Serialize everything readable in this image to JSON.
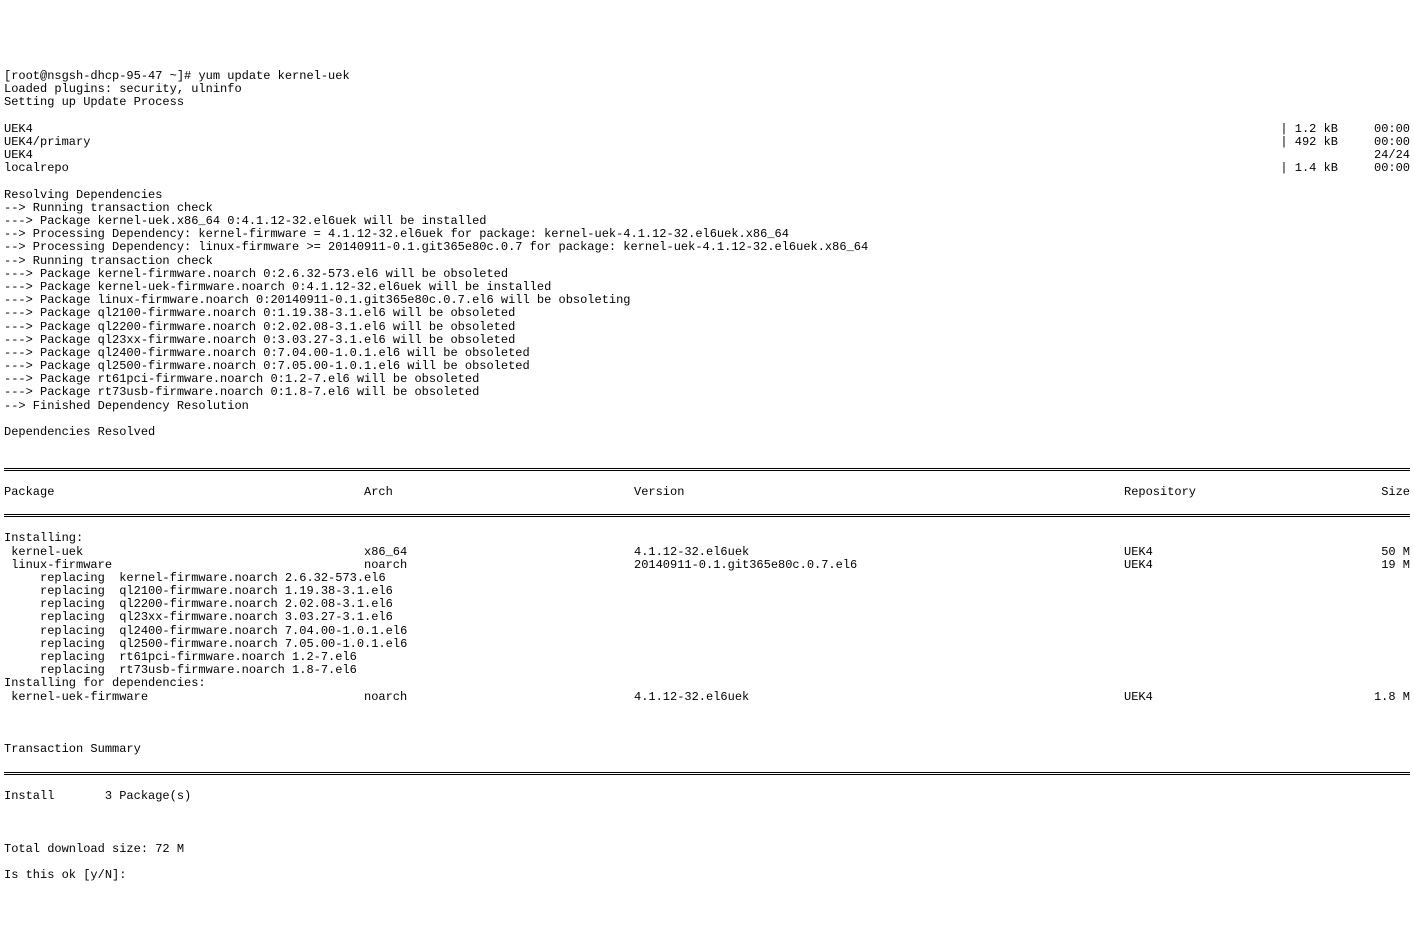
{
  "prompt": "[root@nsgsh-dhcp-95-47 ~]# ",
  "command": "yum update kernel-uek",
  "preamble": [
    "Loaded plugins: security, ulninfo",
    "Setting up Update Process"
  ],
  "repos": [
    {
      "name": "UEK4",
      "right": "| 1.2 kB     00:00"
    },
    {
      "name": "UEK4/primary",
      "right": "| 492 kB     00:00"
    },
    {
      "name": "UEK4",
      "right": "24/24"
    },
    {
      "name": "localrepo",
      "right": "| 1.4 kB     00:00"
    }
  ],
  "deps": [
    "Resolving Dependencies",
    "--> Running transaction check",
    "---> Package kernel-uek.x86_64 0:4.1.12-32.el6uek will be installed",
    "--> Processing Dependency: kernel-firmware = 4.1.12-32.el6uek for package: kernel-uek-4.1.12-32.el6uek.x86_64",
    "--> Processing Dependency: linux-firmware >= 20140911-0.1.git365e80c.0.7 for package: kernel-uek-4.1.12-32.el6uek.x86_64",
    "--> Running transaction check",
    "---> Package kernel-firmware.noarch 0:2.6.32-573.el6 will be obsoleted",
    "---> Package kernel-uek-firmware.noarch 0:4.1.12-32.el6uek will be installed",
    "---> Package linux-firmware.noarch 0:20140911-0.1.git365e80c.0.7.el6 will be obsoleting",
    "---> Package ql2100-firmware.noarch 0:1.19.38-3.1.el6 will be obsoleted",
    "---> Package ql2200-firmware.noarch 0:2.02.08-3.1.el6 will be obsoleted",
    "---> Package ql23xx-firmware.noarch 0:3.03.27-3.1.el6 will be obsoleted",
    "---> Package ql2400-firmware.noarch 0:7.04.00-1.0.1.el6 will be obsoleted",
    "---> Package ql2500-firmware.noarch 0:7.05.00-1.0.1.el6 will be obsoleted",
    "---> Package rt61pci-firmware.noarch 0:1.2-7.el6 will be obsoleted",
    "---> Package rt73usb-firmware.noarch 0:1.8-7.el6 will be obsoleted",
    "--> Finished Dependency Resolution",
    "",
    "Dependencies Resolved",
    ""
  ],
  "table": {
    "headers": {
      "pkg": "Package",
      "arch": "Arch",
      "ver": "Version",
      "repo": "Repository",
      "size": "Size"
    },
    "sections": [
      {
        "title": "Installing:",
        "rows": [
          {
            "pkg": " kernel-uek",
            "arch": "x86_64",
            "ver": "4.1.12-32.el6uek",
            "repo": "UEK4",
            "size": "50 M"
          },
          {
            "pkg": " linux-firmware",
            "arch": "noarch",
            "ver": "20140911-0.1.git365e80c.0.7.el6",
            "repo": "UEK4",
            "size": "19 M"
          }
        ],
        "replacing": [
          "     replacing  kernel-firmware.noarch 2.6.32-573.el6",
          "     replacing  ql2100-firmware.noarch 1.19.38-3.1.el6",
          "     replacing  ql2200-firmware.noarch 2.02.08-3.1.el6",
          "     replacing  ql23xx-firmware.noarch 3.03.27-3.1.el6",
          "     replacing  ql2400-firmware.noarch 7.04.00-1.0.1.el6",
          "     replacing  ql2500-firmware.noarch 7.05.00-1.0.1.el6",
          "     replacing  rt61pci-firmware.noarch 1.2-7.el6",
          "     replacing  rt73usb-firmware.noarch 1.8-7.el6"
        ]
      },
      {
        "title": "Installing for dependencies:",
        "rows": [
          {
            "pkg": " kernel-uek-firmware",
            "arch": "noarch",
            "ver": "4.1.12-32.el6uek",
            "repo": "UEK4",
            "size": "1.8 M"
          }
        ],
        "replacing": []
      }
    ]
  },
  "summary": {
    "title": "Transaction Summary",
    "install_line": "Install       3 Package(s)",
    "download": "Total download size: 72 M",
    "confirm": "Is this ok [y/N]: "
  }
}
